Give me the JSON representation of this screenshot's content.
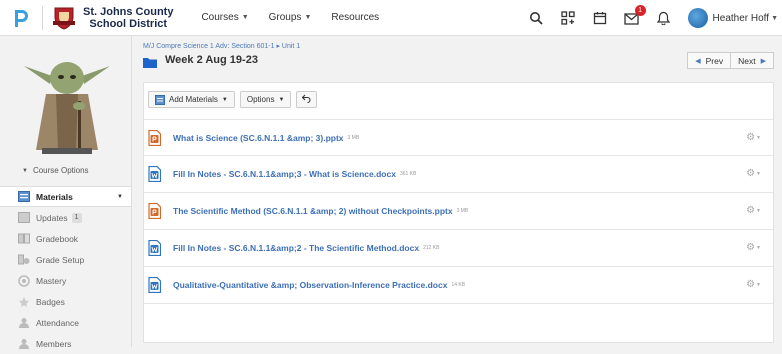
{
  "header": {
    "district_line1": "St. Johns County",
    "district_line2": "School District",
    "nav": [
      {
        "label": "Courses",
        "has_dropdown": true
      },
      {
        "label": "Groups",
        "has_dropdown": true
      },
      {
        "label": "Resources",
        "has_dropdown": false
      }
    ],
    "icons": [
      "search-icon",
      "apps-grid-icon",
      "calendar-icon",
      "messages-icon",
      "bell-icon"
    ],
    "message_badge": "1",
    "user_name": "Heather Hoff"
  },
  "sidebar": {
    "course_options_label": "Course Options",
    "items": [
      {
        "label": "Materials",
        "icon": "materials-icon",
        "active": true
      },
      {
        "label": "Updates",
        "icon": "updates-icon",
        "badge": "1"
      },
      {
        "label": "Gradebook",
        "icon": "gradebook-icon"
      },
      {
        "label": "Grade Setup",
        "icon": "grade-setup-icon"
      },
      {
        "label": "Mastery",
        "icon": "mastery-icon"
      },
      {
        "label": "Badges",
        "icon": "badges-icon"
      },
      {
        "label": "Attendance",
        "icon": "attendance-icon"
      },
      {
        "label": "Members",
        "icon": "members-icon"
      }
    ]
  },
  "main": {
    "breadcrumb": "M/J Compre Science 1 Adv: Section 601-1 ▸ Unit 1",
    "title": "Week 2 Aug 19-23",
    "prev_label": "Prev",
    "next_label": "Next",
    "toolbar": {
      "add_materials": "Add Materials",
      "options": "Options"
    },
    "materials": [
      {
        "title": "What is Science (SC.6.N.1.1 &amp; 3).pptx",
        "size": "3 MB",
        "type": "pptx"
      },
      {
        "title": "Fill In Notes - SC.6.N.1.1&amp;3 - What is Science.docx",
        "size": "361 KB",
        "type": "docx"
      },
      {
        "title": "The Scientific Method (SC.6.N.1.1 &amp; 2) without Checkpoints.pptx",
        "size": "3 MB",
        "type": "pptx"
      },
      {
        "title": "Fill In Notes - SC.6.N.1.1&amp;2 - The Scientific Method.docx",
        "size": "212 KB",
        "type": "docx"
      },
      {
        "title": "Qualitative-Quantitative &amp; Observation-Inference Practice.docx",
        "size": "14 KB",
        "type": "docx"
      }
    ]
  },
  "colors": {
    "link": "#3d6fb5",
    "pptx": "#d26a2e",
    "docx": "#2f74c0",
    "badge": "#d8232a"
  }
}
